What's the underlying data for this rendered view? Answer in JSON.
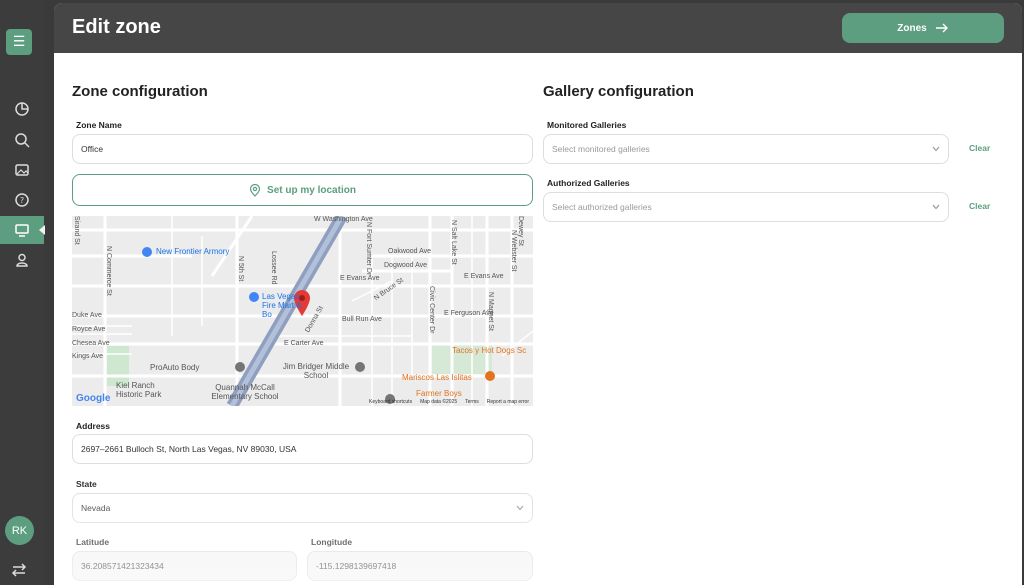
{
  "sidebar": {
    "menu_icon": "menu-icon",
    "items": [
      {
        "icon": "dashboard-icon"
      },
      {
        "icon": "search-icon"
      },
      {
        "icon": "image-icon"
      },
      {
        "icon": "help-icon"
      },
      {
        "icon": "monitor-icon",
        "active": true
      },
      {
        "icon": "user-icon"
      }
    ],
    "avatar_initials": "RK",
    "swap_icon": "swap-icon"
  },
  "header": {
    "title": "Edit zone",
    "zones_button": "Zones"
  },
  "zone_config": {
    "title": "Zone configuration",
    "zone_name_label": "Zone Name",
    "zone_name_value": "Office",
    "location_button": "Set up my location",
    "address_label": "Address",
    "address_value": "2697–2661 Bulloch St, North Las Vegas, NV 89030, USA",
    "state_label": "State",
    "state_value": "Nevada",
    "latitude_label": "Latitude",
    "latitude_value": "36.208571421323434",
    "longitude_label": "Longitude",
    "longitude_value": "-115.1298139697418"
  },
  "gallery_config": {
    "title": "Gallery configuration",
    "monitored_label": "Monitored Galleries",
    "monitored_placeholder": "Select monitored galleries",
    "authorized_label": "Authorized Galleries",
    "authorized_placeholder": "Select authorized galleries",
    "clear_label": "Clear"
  },
  "map": {
    "streets": [
      "W Washington Ave",
      "Lossee Rd",
      "N 5th St",
      "N Commerce St",
      "N Fort Sumter Dr",
      "Oakwood Ave",
      "Dogwood Ave",
      "E Evans Ave",
      "E Evans Ave",
      "N Bruce St",
      "Bull Run Ave",
      "E Ferguson Ave",
      "E Carter Ave",
      "Civic Center Dr",
      "N Salt Lake St",
      "N Webster St",
      "N Magnet St",
      "Donna St",
      "Duke Ave",
      "Royce Ave",
      "Chesea Ave",
      "Kings Ave",
      "Sirand St",
      "Dewey St"
    ],
    "pois": [
      "New Frontier Armory",
      "Las Vegas Fire Mart & Bo",
      "ProAuto Body",
      "Jim Bridger Middle School",
      "Kiel Ranch Historic Park",
      "Quannah McCall Elementary School",
      "Tacos y Hot Dogs Sc",
      "Mariscos Las Islitas",
      "Farmer Boys"
    ],
    "footer": [
      "Keyboard shortcuts",
      "Map data ©2025",
      "Terms",
      "Report a map error"
    ],
    "logo": "Google",
    "colors": {
      "road": "#ffffff",
      "highway": "#8e9fbf",
      "park": "#cde8cf",
      "pin": "#e53935"
    }
  }
}
